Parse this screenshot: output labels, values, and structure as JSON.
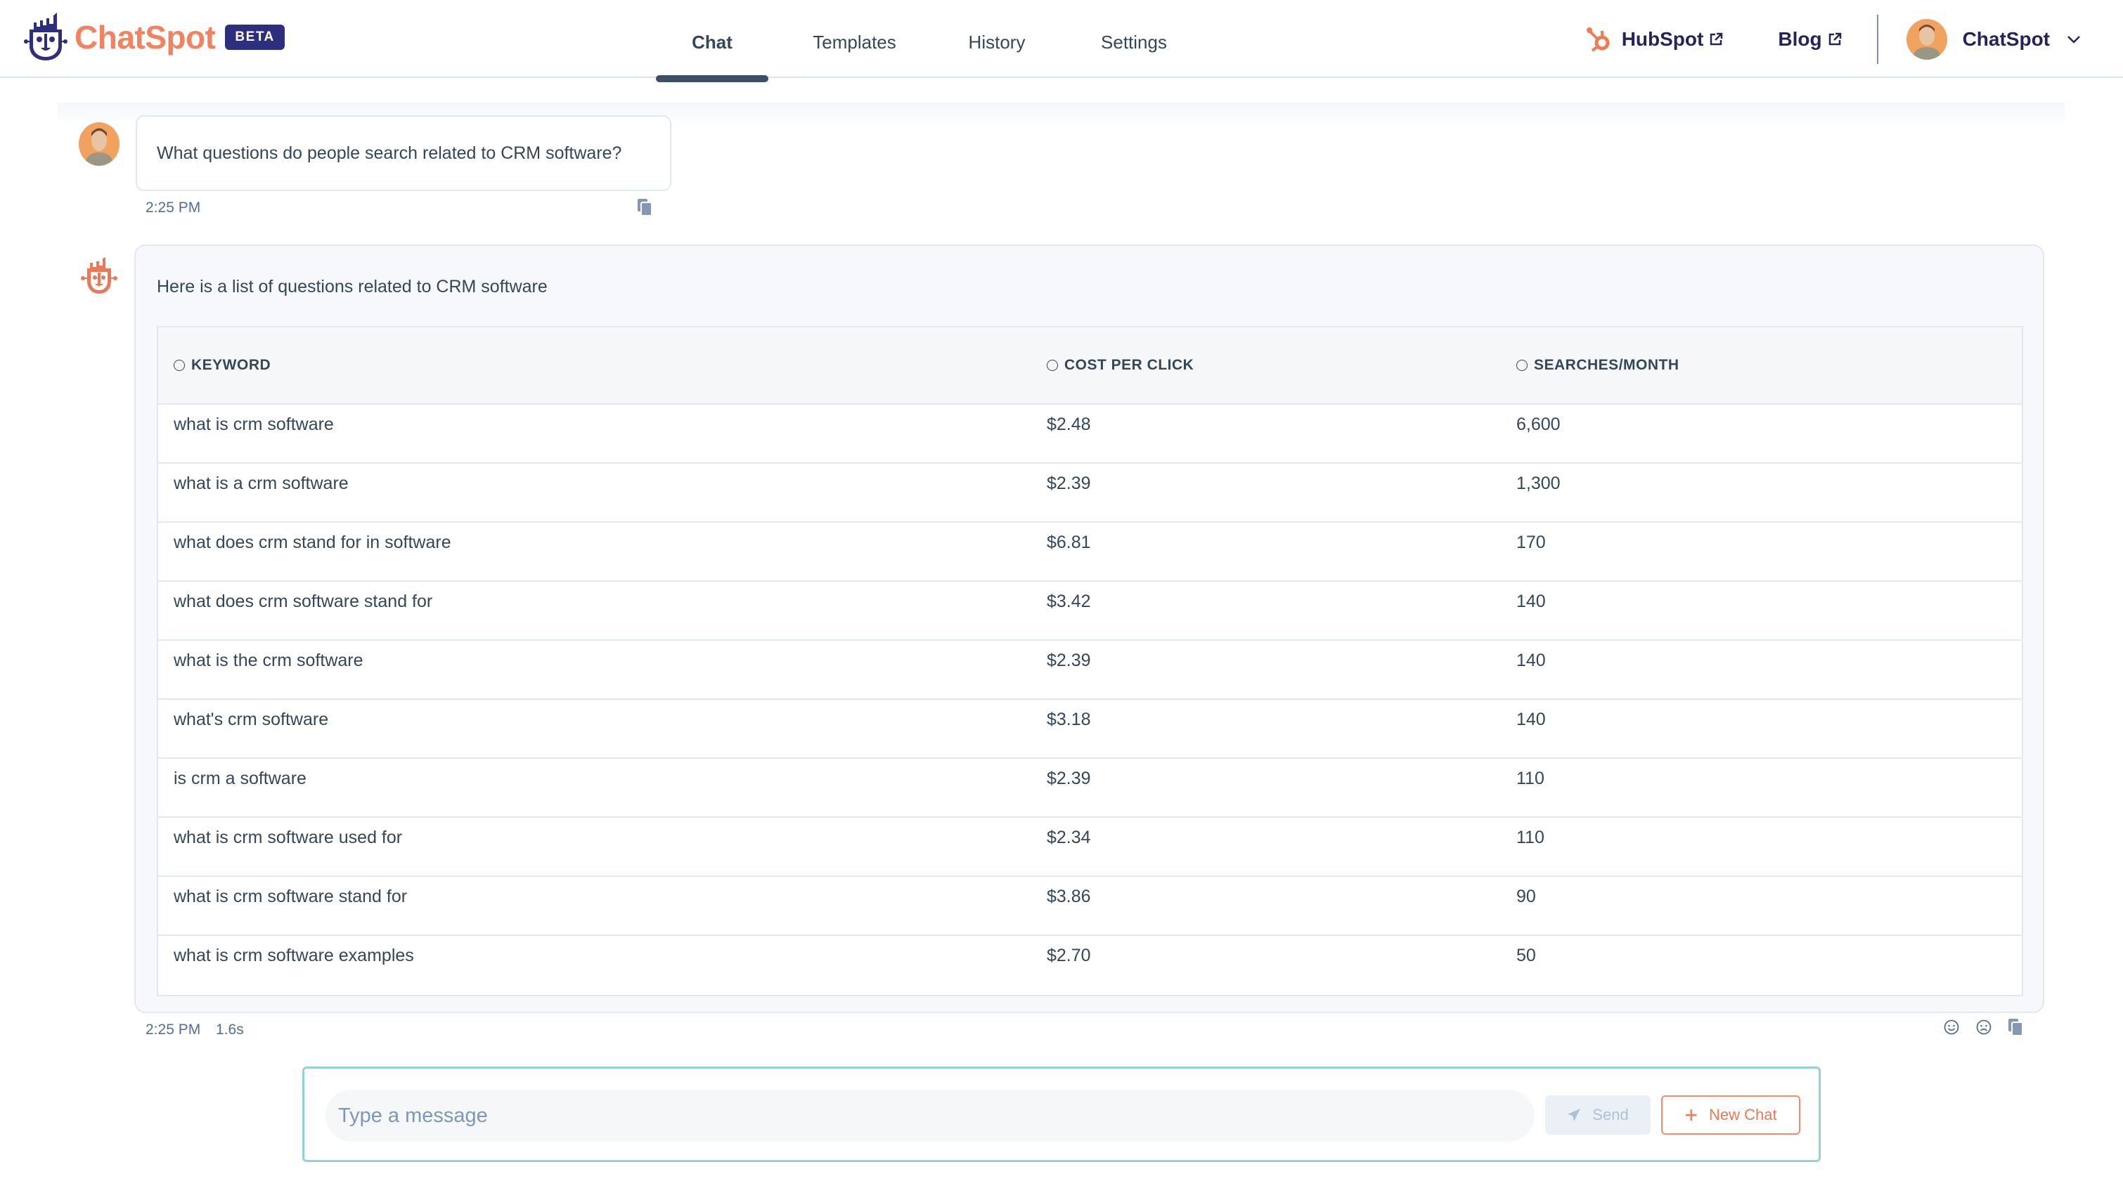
{
  "header": {
    "brand": "ChatSpot",
    "badge": "BETA",
    "tabs": [
      {
        "label": "Chat",
        "active": true
      },
      {
        "label": "Templates",
        "active": false
      },
      {
        "label": "History",
        "active": false
      },
      {
        "label": "Settings",
        "active": false
      }
    ],
    "links": [
      {
        "label": "HubSpot",
        "icon": "hubspot-sprocket-icon",
        "external": true
      },
      {
        "label": "Blog",
        "external": true
      }
    ],
    "user": {
      "name": "ChatSpot",
      "menu_icon": "chevron-down-icon"
    }
  },
  "colors": {
    "brand_orange": "#f08461",
    "brand_navy": "#2d2e7e",
    "text": "#33475b",
    "input_border": "#94cfdb"
  },
  "conversation": {
    "user_message": {
      "text": "What questions do people search related to CRM software?",
      "time": "2:25 PM"
    },
    "bot_message": {
      "intro": "Here is a list of questions related to CRM software",
      "time": "2:25 PM",
      "duration": "1.6s",
      "table": {
        "columns": [
          "KEYWORD",
          "COST PER CLICK",
          "SEARCHES/MONTH"
        ],
        "rows": [
          [
            "what is crm software",
            "$2.48",
            "6,600"
          ],
          [
            "what is a crm software",
            "$2.39",
            "1,300"
          ],
          [
            "what does crm stand for in software",
            "$6.81",
            "170"
          ],
          [
            "what does crm software stand for",
            "$3.42",
            "140"
          ],
          [
            "what is the crm software",
            "$2.39",
            "140"
          ],
          [
            "what's crm software",
            "$3.18",
            "140"
          ],
          [
            "is crm a software",
            "$2.39",
            "110"
          ],
          [
            "what is crm software used for",
            "$2.34",
            "110"
          ],
          [
            "what is crm software stand for",
            "$3.86",
            "90"
          ],
          [
            "what is crm software examples",
            "$2.70",
            "50"
          ]
        ]
      }
    }
  },
  "composer": {
    "placeholder": "Type a message",
    "value": "",
    "send_label": "Send",
    "new_chat_label": "New Chat"
  }
}
